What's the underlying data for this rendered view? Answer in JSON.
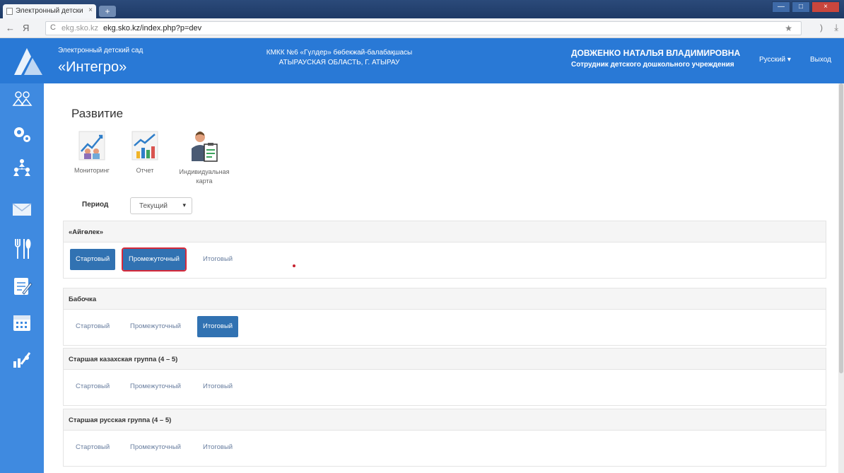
{
  "browser": {
    "tab_title": "Электронный детски",
    "tab_close": "×",
    "new_tab": "+",
    "win_min": "—",
    "win_max": "□",
    "win_close": "×",
    "back": "←",
    "yandex": "Я",
    "reload": "C",
    "url_host": "ekg.sko.kz",
    "url": "ekg.sko.kz/index.php?p=dev",
    "star": "★",
    "extra": ")",
    "download": "⤓"
  },
  "header": {
    "brand_sub": "Электронный детский сад",
    "brand_title": "«Интегро»",
    "org_line1": "КМКК №6 «Гүлдер» бөбекжай-балабақшасы",
    "org_line2": "АТЫРАУСКАЯ ОБЛАСТЬ, Г. АТЫРАУ",
    "user_name": "ДОВЖЕНКО НАТАЛЬЯ ВЛАДИМИРОВНА",
    "user_role": "Сотрудник детского дошкольного учреждения",
    "language": "Русский ▾",
    "logout": "Выход"
  },
  "sidebar": {
    "items": [
      "children-icon",
      "settings-icon",
      "structure-icon",
      "mail-icon",
      "food-icon",
      "notes-icon",
      "calendar-icon",
      "development-icon"
    ]
  },
  "main": {
    "title": "Развитие",
    "tools": [
      {
        "label": "Мониторинг",
        "icon": "monitoring-icon"
      },
      {
        "label": "Отчет",
        "icon": "report-icon"
      },
      {
        "label": "Индивидуальная карта",
        "icon": "individual-card-icon"
      }
    ],
    "period_label": "Период",
    "period_value": "Текущий",
    "period_caret": "▾",
    "groups": [
      {
        "name": "«Айгөлек»",
        "stages": [
          "Стартовый",
          "Промежуточный",
          "Итоговый"
        ],
        "active": 1
      },
      {
        "name": "Бабочка",
        "stages": [
          "Стартовый",
          "Промежуточный",
          "Итоговый"
        ],
        "active": 2
      },
      {
        "name": "Старшая казахская группа (4 – 5)",
        "stages": [
          "Стартовый",
          "Промежуточный",
          "Итоговый"
        ],
        "active": null
      },
      {
        "name": "Старшая русская группа (4 – 5)",
        "stages": [
          "Стартовый",
          "Промежуточный",
          "Итоговый"
        ],
        "active": null
      }
    ]
  },
  "colors": {
    "header": "#2979d6",
    "sidebar": "#3f8ae0",
    "active_stage": "#3172b2",
    "highlight": "#d6293a"
  }
}
